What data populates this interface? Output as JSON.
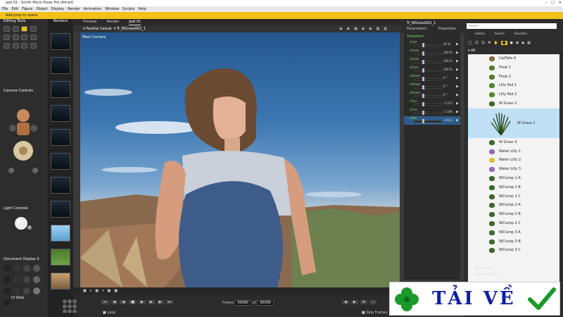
{
  "titlebar": {
    "title": "Jadi 01 - Smith Micro Poser Pro (64-bit)"
  },
  "menu": {
    "items": [
      "File",
      "Edit",
      "Figure",
      "Object",
      "Display",
      "Render",
      "Animation",
      "Window",
      "Scripts",
      "Help"
    ]
  },
  "status": {
    "text": "Add prop to scene"
  },
  "left_panel": {
    "editing_tools": "Editing Tools",
    "camera_controls": "Camera Controls",
    "light_controls": "Light Controls",
    "document_display": "Document Display S"
  },
  "renders_panel": {
    "label": "Renders"
  },
  "view_tabs": [
    "Preview",
    "Render",
    "Jadi 01"
  ],
  "view_toolbar": {
    "figure": "Pauline Casual",
    "prop": "Tr_WGrass002_1"
  },
  "viewport": {
    "camera_label": "Main Camera"
  },
  "timeline": {
    "ui_dots": "UI Dots",
    "loop_label": "Loop",
    "frame_label": "Frame",
    "frame_value": "00090",
    "of_label": "of",
    "frame_total": "00090",
    "skip_frames": "Skip Frames"
  },
  "param_panel": {
    "object_name": "Tr_WGrass002_1",
    "tabs": [
      "Parameters",
      "Properties"
    ],
    "section": "Transform",
    "rows": [
      {
        "name": "Scale",
        "value": "45 %"
      },
      {
        "name": "xScale",
        "value": "100 %"
      },
      {
        "name": "yScale",
        "value": "100 %"
      },
      {
        "name": "zScale",
        "value": "100 %"
      },
      {
        "name": "yRotate",
        "value": "0 °"
      },
      {
        "name": "xRotate",
        "value": "0 °"
      },
      {
        "name": "zRotate",
        "value": "0 °"
      },
      {
        "name": "xTran",
        "value": "-1.273"
      },
      {
        "name": "yTran",
        "value": "-1.166"
      },
      {
        "name": "zTran",
        "value": "-3.613"
      }
    ]
  },
  "library": {
    "search_placeholder": "Search",
    "tabs": [
      "Library",
      "Search",
      "Favorites"
    ],
    "filter": "All",
    "folders": [
      "Places",
      "Primitives"
    ],
    "items": [
      {
        "label": "CatTails 4",
        "icon": "cattail-icon",
        "selected": false
      },
      {
        "label": "Float 1",
        "icon": "plant-icon",
        "selected": false
      },
      {
        "label": "Float 2",
        "icon": "plant-icon",
        "selected": false
      },
      {
        "label": "Lilly Pad 1",
        "icon": "lilypad-icon",
        "selected": false
      },
      {
        "label": "Lilly Pad 2",
        "icon": "lilypad-icon",
        "selected": false
      },
      {
        "label": "W Grass 1",
        "icon": "grass-icon",
        "selected": false
      },
      {
        "label": "W Grass 2",
        "icon": "grass-icon",
        "selected": true
      },
      {
        "label": "W Grass 3",
        "icon": "grass-icon",
        "selected": false
      },
      {
        "label": "Water Lilly 1",
        "icon": "flower-icon",
        "selected": false
      },
      {
        "label": "Water Lilly 2",
        "icon": "flower-icon",
        "selected": false
      },
      {
        "label": "Water Lilly 3",
        "icon": "flower-icon",
        "selected": false
      },
      {
        "label": "WClump 1 A",
        "icon": "grass-icon",
        "selected": false
      },
      {
        "label": "WClump 1 B",
        "icon": "grass-icon",
        "selected": false
      },
      {
        "label": "WClump 1 C",
        "icon": "grass-icon",
        "selected": false
      },
      {
        "label": "WClump 2 A",
        "icon": "grass-icon",
        "selected": false
      },
      {
        "label": "WClump 2 B",
        "icon": "grass-icon",
        "selected": false
      },
      {
        "label": "WClump 2 C",
        "icon": "grass-icon",
        "selected": false
      },
      {
        "label": "WClump 3 A",
        "icon": "grass-icon",
        "selected": false
      },
      {
        "label": "WClump 3 B",
        "icon": "grass-icon",
        "selected": false
      },
      {
        "label": "WClump 3 C",
        "icon": "grass-icon",
        "selected": false
      }
    ]
  },
  "watermark": {
    "text": "TẢI VỀ"
  },
  "colors": {
    "accent": "#f2c11a",
    "selection": "#bfe0f5",
    "param_label": "#7fdc66"
  }
}
